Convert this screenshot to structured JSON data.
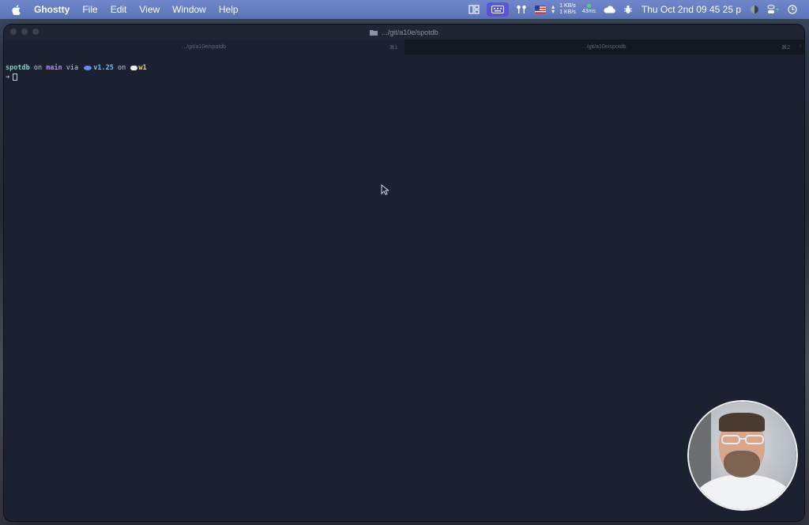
{
  "menubar": {
    "app_name": "Ghostty",
    "items": [
      "File",
      "Edit",
      "View",
      "Window",
      "Help"
    ],
    "net_up": "1 KB/s",
    "net_down": "1 KB/s",
    "ping": "43ms",
    "clock": "Thu Oct 2nd  09 45 25 p"
  },
  "window": {
    "title": ".../git/a10e/spotdb",
    "tabs": [
      {
        "label": ".../git/a10e/spotdb",
        "shortcut": "⌘1"
      },
      {
        "label": ".../git/a10e/spotdb",
        "shortcut": "⌘2"
      }
    ]
  },
  "terminal": {
    "dir": "spotdb",
    "on1": " on ",
    "branch_icon": "",
    "branch": "main",
    "via": " via ",
    "version": "v1.25",
    "on2": " on ",
    "workspace": "w1",
    "prompt_arrow": "➜"
  },
  "colors": {
    "menubar": "#5f78bf",
    "terminal_bg": "#1b2130",
    "dir": "#7fd0c3",
    "branch": "#b48ef2",
    "version": "#7fb8f2",
    "workspace": "#e8d66a"
  }
}
